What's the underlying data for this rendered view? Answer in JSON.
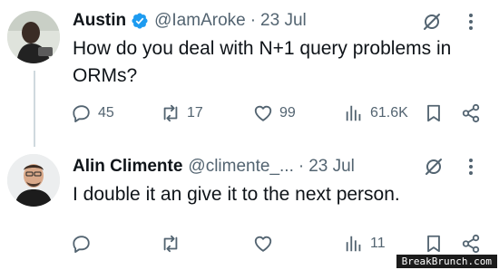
{
  "tweets": [
    {
      "author_name": "Austin",
      "handle": "@IamAroke",
      "separator": "·",
      "date": "23 Jul",
      "text": "How do you deal with N+1 query problems in ORMs?",
      "replies": "45",
      "reposts": "17",
      "likes": "99",
      "views": "61.6K",
      "verified": true
    },
    {
      "author_name": "Alin Climente",
      "handle": "@climente_...",
      "separator": "·",
      "date": "23 Jul",
      "text": "I double it an give it to the next person.",
      "replies": "",
      "reposts": "",
      "likes": "",
      "views": "11",
      "verified": false
    }
  ],
  "icons": {
    "verified": "verified-badge-icon",
    "grok": "grok-icon",
    "more": "more-options-icon",
    "reply": "reply-icon",
    "repost": "repost-icon",
    "like": "like-icon",
    "views": "views-icon",
    "bookmark": "bookmark-icon",
    "share": "share-icon"
  },
  "colors": {
    "text": "#0f1419",
    "secondary": "#536471",
    "verified": "#1d9bf0",
    "thread_line": "#cfd9de"
  },
  "watermark": "BreakBrunch.com"
}
